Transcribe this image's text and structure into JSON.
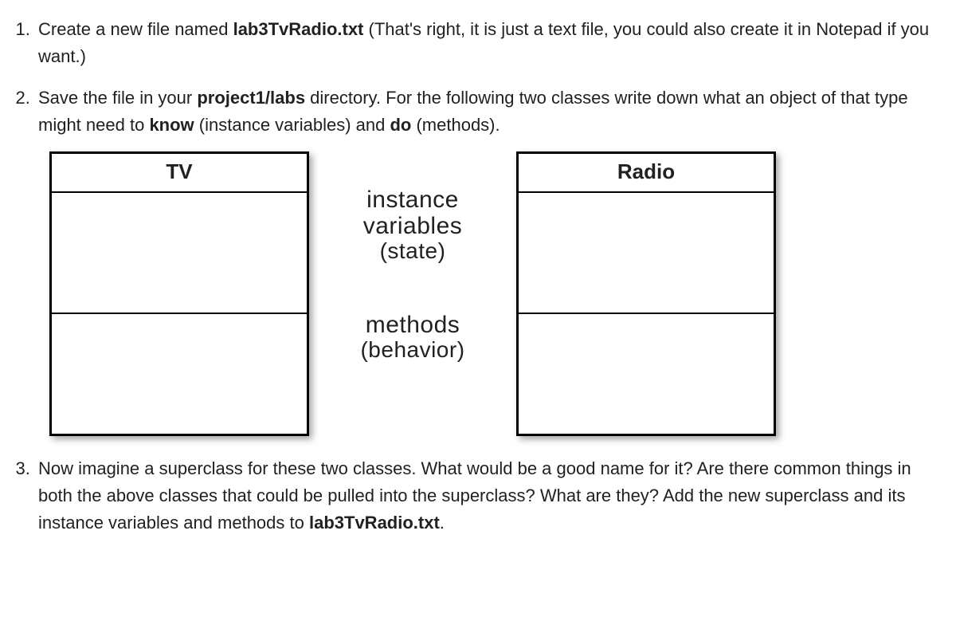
{
  "items": {
    "i1": {
      "pre": "Create a new file named ",
      "bold": "lab3TvRadio.txt",
      "post": " (That's right, it is just a text file, you could also create it in Notepad if you want.)"
    },
    "i2": {
      "a": "Save the file in your ",
      "b": "project1/labs",
      "c": " directory. For the following two classes write down what an object of that type might need to ",
      "d": "know",
      "e": " (instance variables) and ",
      "f": "do",
      "g": " (methods)."
    },
    "i3": {
      "a": "Now imagine a superclass for these two classes. What would be a good name for it? Are there common things in both the above classes that could be pulled into the superclass? What are they? Add the new superclass and its instance variables and methods to ",
      "b": "lab3TvRadio.txt",
      "c": "."
    }
  },
  "diagram": {
    "left_title": "TV",
    "right_title": "Radio",
    "label1_line1": "instance",
    "label1_line2": "variables",
    "label1_line3": "(state)",
    "label2_line1": "methods",
    "label2_line2": "(behavior)"
  }
}
